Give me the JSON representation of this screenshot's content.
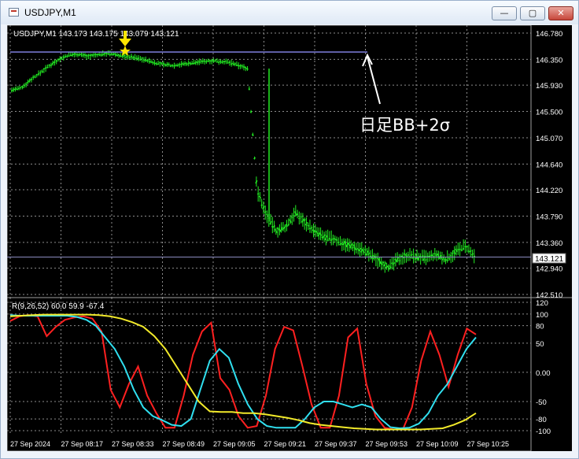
{
  "window": {
    "title": "USDJPY,M1",
    "icons": {
      "app": "chart-window-icon",
      "minimize": "minimize-icon",
      "maximize": "maximize-icon",
      "close": "close-icon"
    }
  },
  "main_header": "USDJPY,M1  143.173 143.175 143.079 143.121",
  "annotation_text": "日足BB+2σ",
  "price_label": "143.121",
  "indicator_header": "R(9,26,52) 60.0 59.9 -67.4",
  "colors": {
    "background": "#000000",
    "grid": "#8c8c8c",
    "candles": "#22ee22",
    "bb_line": "#8a8af0",
    "current_price_line": "#9a9ac8",
    "red_series": "#ff2020",
    "cyan_series": "#30e0f0",
    "yellow_series": "#f2ea2a",
    "arrow": "#ffffff",
    "marker": "#ffe600"
  },
  "chart_data": [
    {
      "type": "line",
      "title": "USDJPY,M1",
      "x": [
        "27 Sep 2024",
        "27 Sep 08:17",
        "27 Sep 08:33",
        "27 Sep 08:49",
        "27 Sep 09:05",
        "27 Sep 09:21",
        "27 Sep 09:37",
        "27 Sep 09:53",
        "27 Sep 10:09",
        "27 Sep 10:25"
      ],
      "y_ticks": [
        146.78,
        146.35,
        145.93,
        145.5,
        145.07,
        144.64,
        144.22,
        143.79,
        143.36,
        142.94,
        142.51
      ],
      "ylim": [
        142.51,
        146.78
      ],
      "series": [
        {
          "values": [
            145.85,
            145.88,
            146.02,
            146.13,
            146.25,
            146.35,
            146.42,
            146.44,
            146.4,
            146.42,
            146.45,
            146.43,
            146.4,
            146.38,
            146.35,
            146.3,
            146.27,
            146.25,
            146.27,
            146.29,
            146.31,
            146.33,
            146.32,
            146.3,
            146.25,
            146.2,
            144.2,
            143.8,
            143.55,
            143.6,
            143.85,
            143.7,
            143.55,
            143.45,
            143.42,
            143.35,
            143.3,
            143.25,
            143.15,
            143.05,
            142.95,
            143.1,
            143.15,
            143.12,
            143.1,
            143.15,
            143.08,
            143.2,
            143.3,
            143.12
          ]
        }
      ],
      "reference_lines": [
        {
          "value": 146.47,
          "label": "日足BB+2σ"
        },
        {
          "value": 143.121
        }
      ],
      "grid": true
    },
    {
      "type": "line",
      "title": "R(9,26,52) 60.0 59.9 -67.4",
      "y_ticks": [
        120,
        100,
        80,
        50,
        0.0,
        -50,
        -80,
        -100
      ],
      "ylim": [
        -100,
        120
      ],
      "series": [
        {
          "values": [
            88,
            96,
            98,
            96,
            62,
            78,
            90,
            94,
            96,
            92,
            70,
            -30,
            -60,
            -20,
            10,
            -40,
            -70,
            -95,
            -95,
            -40,
            30,
            70,
            85,
            -10,
            -30,
            -75,
            -95,
            -92,
            -40,
            40,
            78,
            72,
            10,
            -55,
            -95,
            -95,
            -40,
            60,
            75,
            -20,
            -75,
            -95,
            -98,
            -98,
            -60,
            20,
            70,
            30,
            -25,
            30,
            75,
            65
          ]
        },
        {
          "values": [
            98,
            97,
            97,
            97,
            97,
            97,
            97,
            95,
            90,
            80,
            60,
            40,
            10,
            -30,
            -60,
            -75,
            -82,
            -90,
            -92,
            -80,
            -30,
            20,
            40,
            25,
            -20,
            -55,
            -80,
            -92,
            -95,
            -95,
            -95,
            -80,
            -60,
            -50,
            -50,
            -55,
            -60,
            -55,
            -60,
            -80,
            -94,
            -96,
            -95,
            -88,
            -70,
            -40,
            -20,
            10,
            40,
            60
          ]
        },
        {
          "values": [
            96,
            97,
            98,
            99,
            99,
            99,
            99,
            99,
            98,
            96,
            92,
            86,
            78,
            62,
            40,
            10,
            -20,
            -50,
            -67,
            -68,
            -68,
            -70,
            -70,
            -72,
            -75,
            -78,
            -82,
            -87,
            -90,
            -92,
            -94,
            -96,
            -97,
            -98,
            -98,
            -98,
            -98,
            -98,
            -97,
            -96,
            -90,
            -82,
            -70
          ]
        }
      ],
      "grid": true
    }
  ]
}
